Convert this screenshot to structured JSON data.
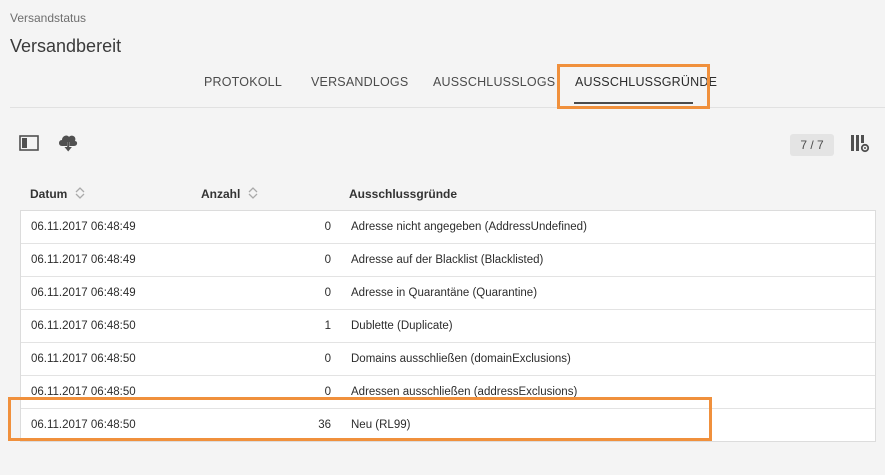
{
  "header": {
    "section_label": "Versandstatus",
    "title": "Versandbereit"
  },
  "tabs": [
    {
      "label": "PROTOKOLL",
      "active": false
    },
    {
      "label": "VERSANDLOGS",
      "active": false
    },
    {
      "label": "AUSSCHLUSSLOGS",
      "active": false
    },
    {
      "label": "AUSSCHLUSSGRÜNDE",
      "active": true
    }
  ],
  "toolbar": {
    "icons": [
      "sidebar-toggle-icon",
      "cloud-download-icon",
      "column-settings-icon"
    ],
    "count": "7 / 7"
  },
  "table": {
    "columns": [
      "Datum",
      "Anzahl",
      "Ausschlussgründe"
    ],
    "rows": [
      {
        "date": "06.11.2017 06:48:49",
        "count": "0",
        "reason": "Adresse nicht angegeben (AddressUndefined)"
      },
      {
        "date": "06.11.2017 06:48:49",
        "count": "0",
        "reason": "Adresse auf der Blacklist (Blacklisted)"
      },
      {
        "date": "06.11.2017 06:48:49",
        "count": "0",
        "reason": "Adresse in Quarantäne (Quarantine)"
      },
      {
        "date": "06.11.2017 06:48:50",
        "count": "1",
        "reason": "Dublette (Duplicate)"
      },
      {
        "date": "06.11.2017 06:48:50",
        "count": "0",
        "reason": "Domains ausschließen (domainExclusions)"
      },
      {
        "date": "06.11.2017 06:48:50",
        "count": "0",
        "reason": "Adressen ausschließen (addressExclusions)"
      },
      {
        "date": "06.11.2017 06:48:50",
        "count": "36",
        "reason": "Neu (RL99)"
      }
    ]
  },
  "colors": {
    "highlight": "#f0903c",
    "background": "#f4f4f4"
  }
}
